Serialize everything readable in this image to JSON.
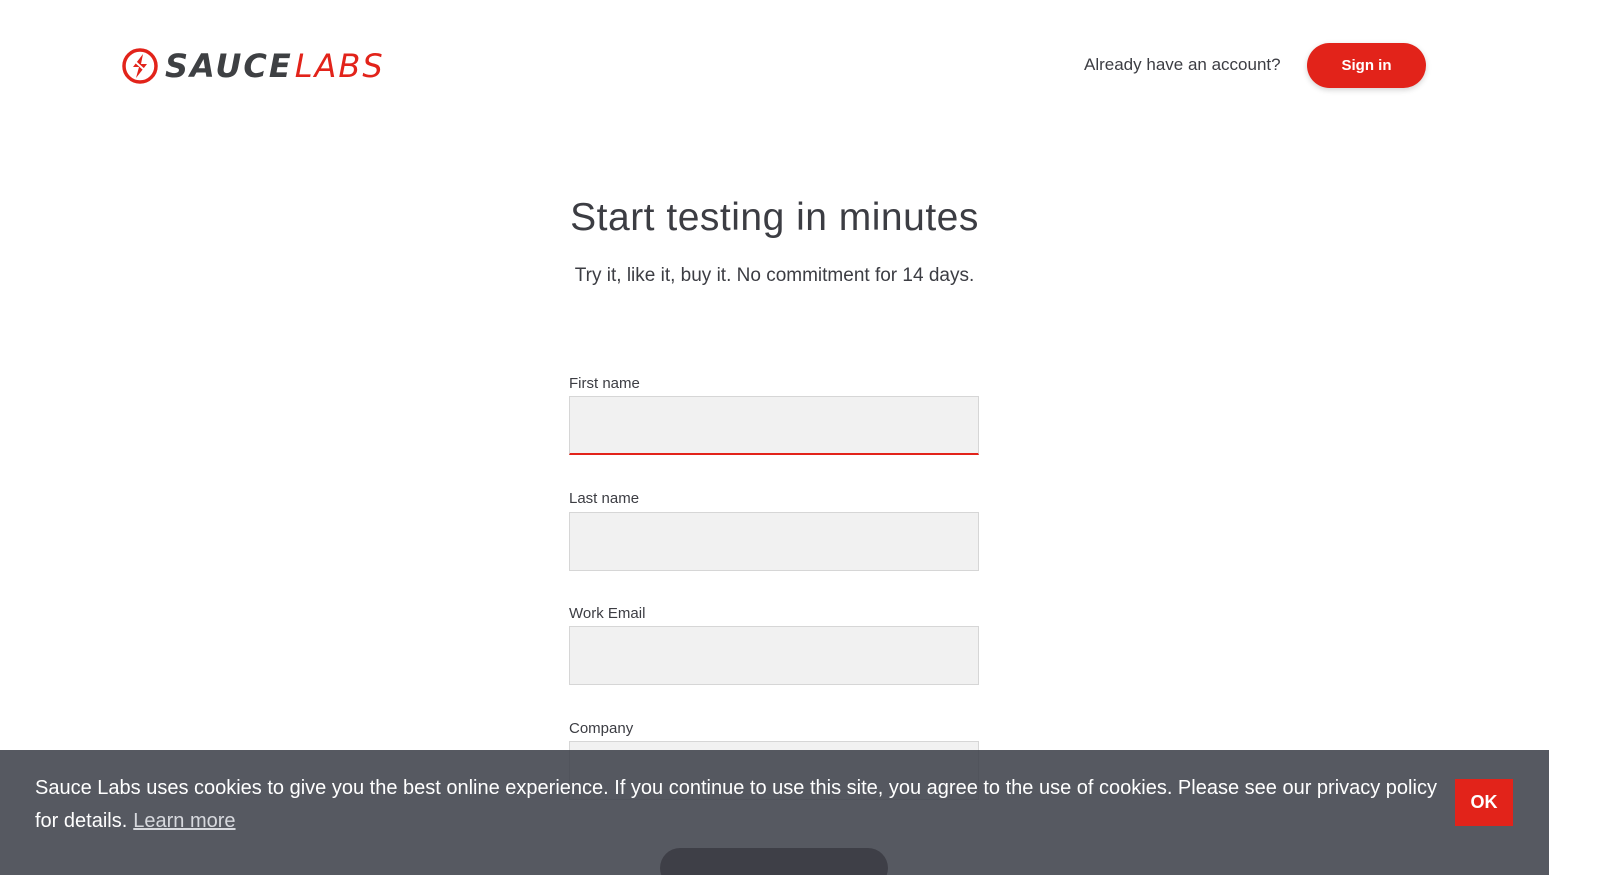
{
  "header": {
    "logo_primary": "SAUCE",
    "logo_secondary": "LABS",
    "account_prompt": "Already have an account?",
    "signin_label": "Sign in"
  },
  "hero": {
    "title": "Start testing in minutes",
    "subtitle": "Try it, like it, buy it. No commitment for 14 days."
  },
  "form": {
    "fields": [
      {
        "label": "First name",
        "value": ""
      },
      {
        "label": "Last name",
        "value": ""
      },
      {
        "label": "Work Email",
        "value": ""
      },
      {
        "label": "Company",
        "value": ""
      }
    ]
  },
  "cookie_banner": {
    "message": "Sauce Labs uses cookies to give you the best online experience. If you continue to use this site, you agree to the use of cookies. Please see our privacy policy for details.",
    "learn_more_label": "Learn more",
    "ok_label": "OK"
  },
  "colors": {
    "brand_red": "#e2231a",
    "text_dark": "#3c3d43",
    "input_bg": "#f1f1f1",
    "banner_bg": "#3f424b"
  },
  "icons": {
    "logo": "sauce-labs-bolt-icon"
  }
}
